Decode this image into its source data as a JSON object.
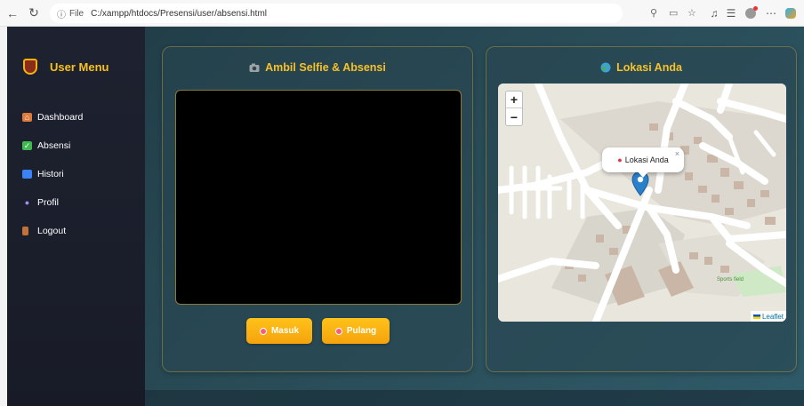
{
  "browser": {
    "back_icon": "back-arrow-icon",
    "refresh_icon": "refresh-icon",
    "address_prefix": "File",
    "url": "C:/xampp/htdocs/Presensi/user/absensi.html"
  },
  "sidebar": {
    "title": "User Menu",
    "items": [
      {
        "label": "Dashboard",
        "icon": "home-icon",
        "color": "#e07a3a"
      },
      {
        "label": "Absensi",
        "icon": "checkbox-icon",
        "color": "#3fb950"
      },
      {
        "label": "Histori",
        "icon": "calendar-icon",
        "color": "#3b82f6"
      },
      {
        "label": "Profil",
        "icon": "user-icon",
        "color": "#a78bfa"
      },
      {
        "label": "Logout",
        "icon": "door-icon",
        "color": "#c2713a"
      }
    ]
  },
  "selfie": {
    "title": "Ambil Selfie & Absensi",
    "btn_in": "Masuk",
    "btn_out": "Pulang"
  },
  "map": {
    "title": "Lokasi Anda",
    "zoom_in": "+",
    "zoom_out": "−",
    "popup_text": "Lokasi Anda",
    "popup_close": "×",
    "attribution": "Leaflet",
    "label_sports": "Sports field"
  },
  "colors": {
    "accent": "#f7c12a",
    "button": "#f4a30c",
    "sidebar_bg": "#1e2230",
    "marker": "#2a81cb"
  }
}
